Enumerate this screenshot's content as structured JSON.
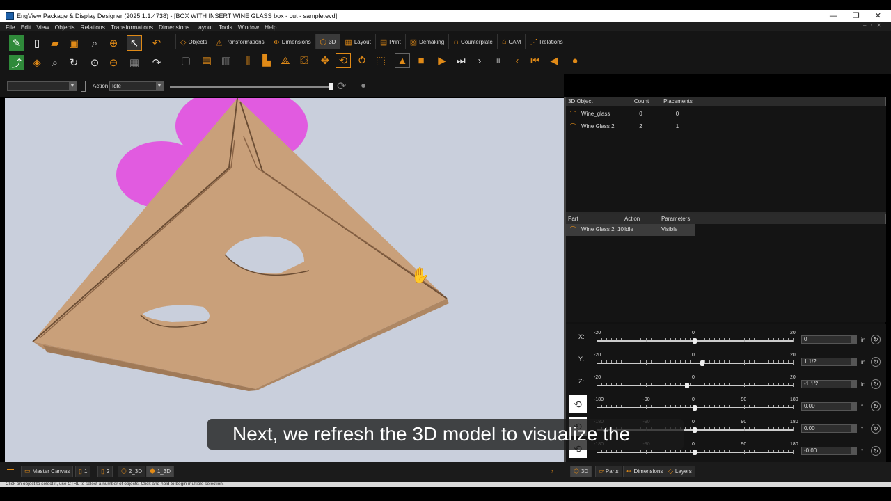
{
  "window": {
    "title": "EngView Package & Display Designer (2025.1.1.4738) - [BOX WITH INSERT WINE GLASS box - cut - sample.evd]"
  },
  "menu": [
    "File",
    "Edit",
    "View",
    "Objects",
    "Relations",
    "Transformations",
    "Dimensions",
    "Layout",
    "Tools",
    "Window",
    "Help"
  ],
  "tabs": [
    "Objects",
    "Transformations",
    "Dimensions",
    "3D",
    "Layout",
    "Print",
    "Demaking",
    "Counterplate",
    "CAM",
    "Relations"
  ],
  "action_bar": {
    "action_label": "Action",
    "action_value": "Idle",
    "progress": 1.0
  },
  "objects_table": {
    "headers": [
      "3D Object",
      "Count",
      "Placements"
    ],
    "rows": [
      {
        "name": "Wine_glass",
        "count": "0",
        "placements": "0"
      },
      {
        "name": "Wine Glass 2",
        "count": "2",
        "placements": "1"
      }
    ]
  },
  "parts_table": {
    "headers": [
      "Part",
      "Action",
      "Parameters ..."
    ],
    "rows": [
      {
        "part": "Wine Glass 2_10",
        "action": "Idle",
        "params": "Visible"
      }
    ]
  },
  "sliders": [
    {
      "axis": "X:",
      "min": "-20",
      "mid": "0",
      "max": "20",
      "value": "0",
      "unit": "in",
      "pos": 0.5
    },
    {
      "axis": "Y:",
      "min": "-20",
      "mid": "0",
      "max": "20",
      "value": "1 1/2",
      "unit": "in",
      "pos": 0.5375
    },
    {
      "axis": "Z:",
      "min": "-20",
      "mid": "0",
      "max": "20",
      "value": "-1 1/2",
      "unit": "in",
      "pos": 0.4625
    }
  ],
  "rot_sliders": [
    {
      "ticks": [
        "-180",
        "-90",
        "0",
        "90",
        "180"
      ],
      "value": "0.00",
      "unit": "°",
      "pos": 0.5
    },
    {
      "ticks": [
        "-180",
        "-90",
        "0",
        "90",
        "180"
      ],
      "value": "0.00",
      "unit": "°",
      "pos": 0.5
    },
    {
      "ticks": [
        "-180",
        "-90",
        "0",
        "90",
        "180"
      ],
      "value": "-0.00",
      "unit": "°",
      "pos": 0.5
    }
  ],
  "bottom_tabs_left": [
    "Master Canvas",
    "1",
    "2",
    "2_3D",
    "1_3D"
  ],
  "bottom_tabs_right": [
    "3D",
    "Parts",
    "Dimensions",
    "Layers"
  ],
  "status": "Click on object to select it, use CTRL to select a number of objects. Click and hold to begin multiple selection.",
  "subtitle": "Next, we refresh the 3D model to visualize the",
  "colors": {
    "accent": "#e08a17",
    "viewport_bg": "#c9cfdc",
    "cardboard": "#c9a07a",
    "glass": "#e15be0"
  }
}
